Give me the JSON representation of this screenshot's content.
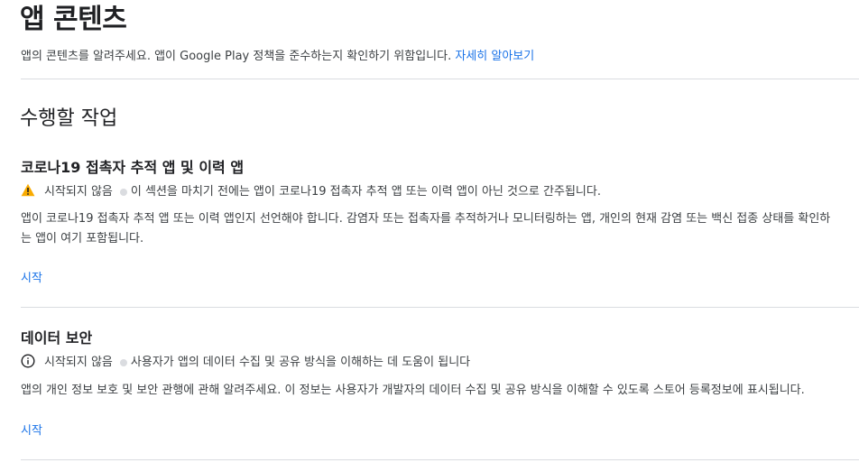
{
  "header": {
    "title": "앱 콘텐츠",
    "subtitle": "앱의 콘텐츠를 알려주세요. 앱이 Google Play 정책을 준수하는지 확인하기 위함입니다.",
    "learn_more": "자세히 알아보기"
  },
  "tasks": {
    "heading": "수행할 작업",
    "items": [
      {
        "title": "코로나19 접촉자 추적 앱 및 이력 앱",
        "status_icon": "warning-icon",
        "status": "시작되지 않음",
        "status_note": "이 섹션을 마치기 전에는 앱이 코로나19 접촉자 추적 앱 또는 이력 앱이 아닌 것으로 간주됩니다.",
        "description": "앱이 코로나19 접촉자 추적 앱 또는 이력 앱인지 선언해야 합니다. 감염자 또는 접촉자를 추적하거나 모니터링하는 앱, 개인의 현재 감염 또는 백신 접종 상태를 확인하는 앱이 여기 포함됩니다.",
        "action": "시작"
      },
      {
        "title": "데이터 보안",
        "status_icon": "info-icon",
        "status": "시작되지 않음",
        "status_note": "사용자가 앱의 데이터 수집 및 공유 방식을 이해하는 데 도움이 됩니다",
        "description": "앱의 개인 정보 보호 및 보안 관행에 관해 알려주세요. 이 정보는 사용자가 개발자의 데이터 수집 및 공유 방식을 이해할 수 있도록 스토어 등록정보에 표시됩니다.",
        "action": "시작"
      }
    ]
  },
  "colors": {
    "accent": "#1a73e8",
    "warning": "#f9ab00",
    "text": "#202124",
    "divider": "#dadce0"
  }
}
